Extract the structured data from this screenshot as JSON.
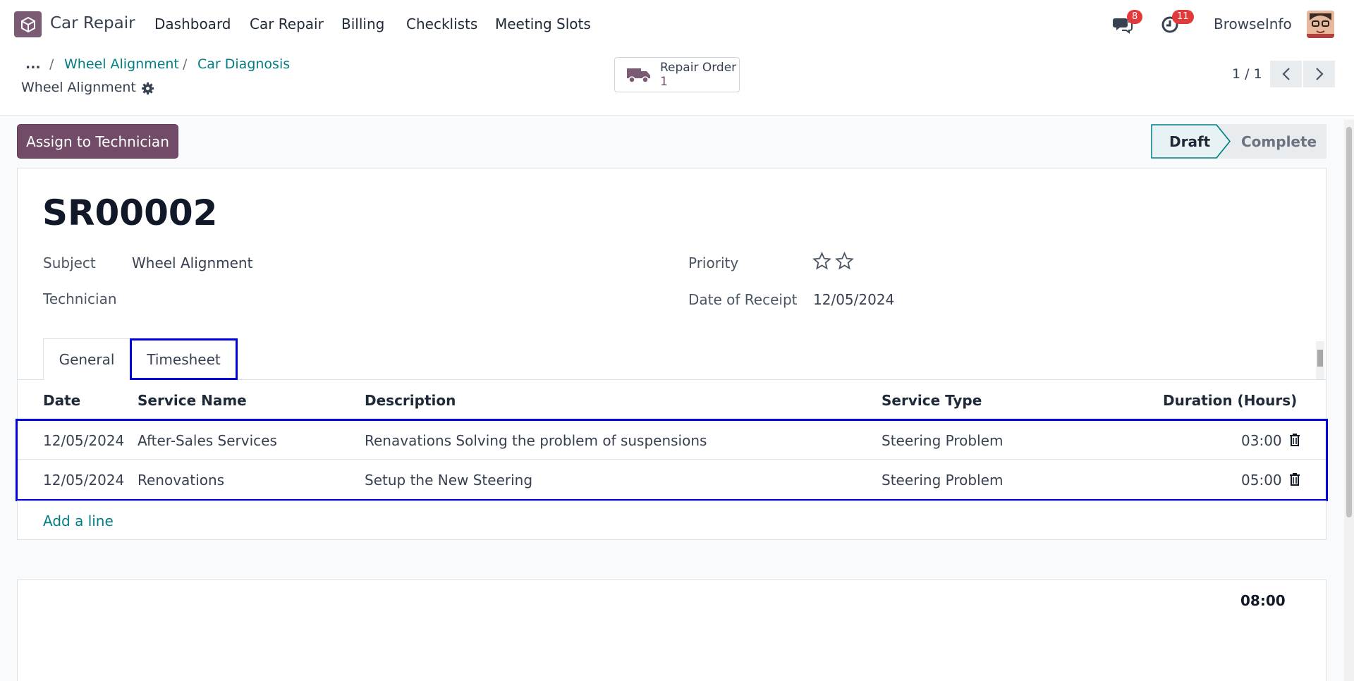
{
  "navbar": {
    "app_name": "Car Repair",
    "menu": [
      "Dashboard",
      "Car Repair",
      "Billing",
      "Checklists",
      "Meeting Slots"
    ],
    "messages_count": "8",
    "activities_count": "11",
    "company": "BrowseInfo"
  },
  "breadcrumb": {
    "ellipsis": "...",
    "sep": "/",
    "items": [
      "Wheel Alignment",
      "Car Diagnosis"
    ],
    "current": "Wheel Alignment"
  },
  "smart_button": {
    "label": "Repair Order",
    "count": "1"
  },
  "pager": {
    "value": "1 / 1"
  },
  "actions": {
    "assign": "Assign to Technician"
  },
  "status": {
    "stages": [
      "Draft",
      "Complete"
    ],
    "active": "Draft"
  },
  "record": {
    "name": "SR00002",
    "subject_label": "Subject",
    "subject": "Wheel Alignment",
    "technician_label": "Technician",
    "technician": "",
    "priority_label": "Priority",
    "date_label": "Date of Receipt",
    "date": "12/05/2024"
  },
  "tabs": [
    "General",
    "Timesheet"
  ],
  "timesheet": {
    "columns": [
      "Date",
      "Service Name",
      "Description",
      "Service Type",
      "Duration (Hours)"
    ],
    "rows": [
      [
        "12/05/2024",
        "After-Sales Services",
        "Renavations Solving the problem of suspensions",
        "Steering Problem",
        "03:00"
      ],
      [
        "12/05/2024",
        "Renovations",
        "Setup the New Steering",
        "Steering Problem",
        "05:00"
      ]
    ],
    "add_line": "Add a line",
    "total": "08:00"
  },
  "colors": {
    "brand": "#714b67",
    "link": "#017e84",
    "highlight": "#0000e0",
    "badge": "#e03a3a"
  }
}
